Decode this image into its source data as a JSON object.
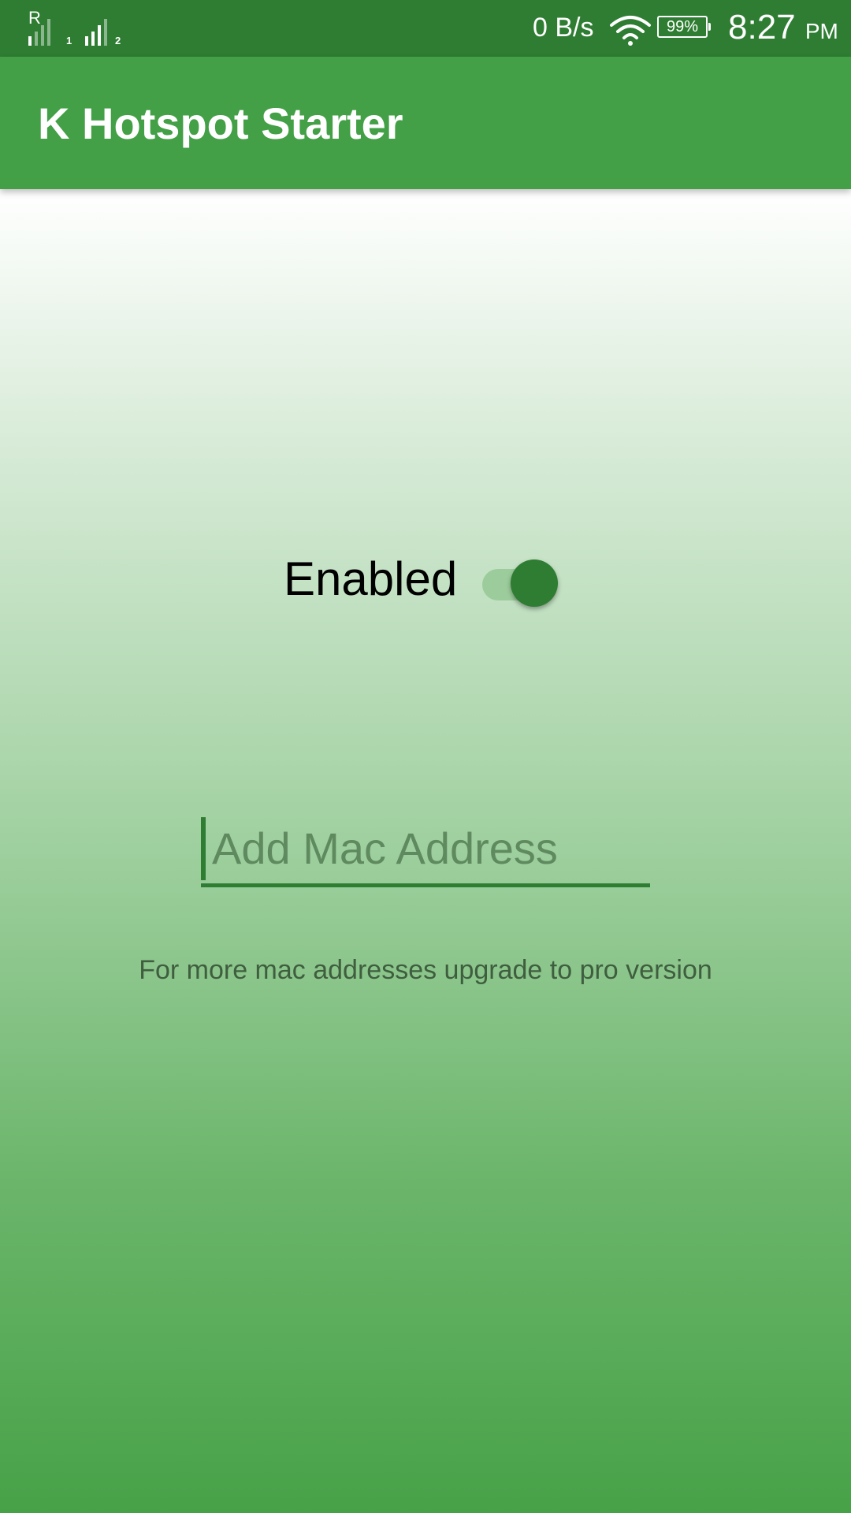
{
  "status_bar": {
    "sim1_roaming": "R",
    "sim1_slot": "1",
    "sim2_slot": "2",
    "net_speed": "0 B/s",
    "battery": "99%",
    "time": "8:27",
    "ampm": "PM",
    "icons": [
      "signal-icon",
      "wifi-icon",
      "battery-icon"
    ]
  },
  "app_bar": {
    "title": "K Hotspot Starter",
    "color": "#43a047"
  },
  "main": {
    "toggle_label": "Enabled",
    "toggle_on": true,
    "mac_input": {
      "placeholder": "Add Mac Address",
      "value": ""
    },
    "hint": "For more mac addresses upgrade to pro version"
  },
  "colors": {
    "status_bar": "#2e7d32",
    "accent": "#2e7d32"
  }
}
